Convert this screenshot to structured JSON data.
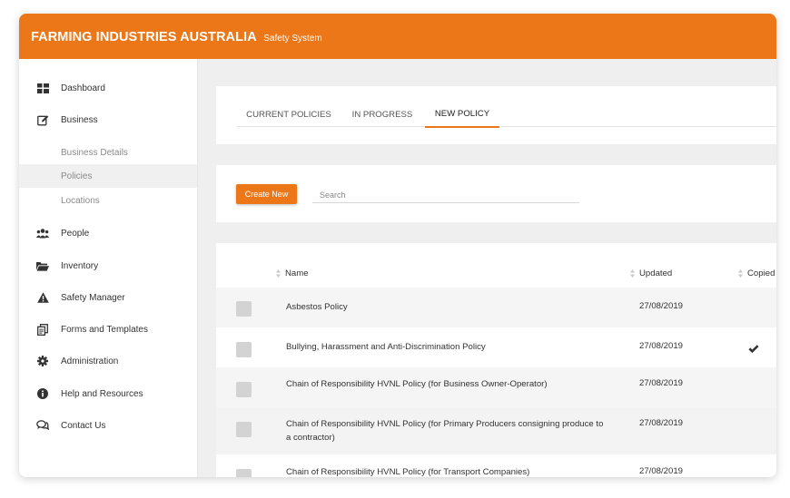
{
  "header": {
    "brand": "FARMING INDUSTRIES AUSTRALIA",
    "subtitle": "Safety System"
  },
  "sidebar": {
    "items": [
      {
        "label": "Dashboard",
        "icon": "dashboard-grid-icon"
      },
      {
        "label": "Business",
        "icon": "edit-icon"
      },
      {
        "label": "People",
        "icon": "users-icon"
      },
      {
        "label": "Inventory",
        "icon": "folder-open-icon"
      },
      {
        "label": "Safety Manager",
        "icon": "warning-icon"
      },
      {
        "label": "Forms and Templates",
        "icon": "documents-icon"
      },
      {
        "label": "Administration",
        "icon": "gear-icon"
      },
      {
        "label": "Help and Resources",
        "icon": "info-icon"
      },
      {
        "label": "Contact Us",
        "icon": "chat-icon"
      }
    ],
    "sub_items": [
      {
        "label": "Business Details"
      },
      {
        "label": "Policies",
        "active": true
      },
      {
        "label": "Locations"
      }
    ]
  },
  "tabs": [
    {
      "label": "CURRENT POLICIES"
    },
    {
      "label": "IN PROGRESS"
    },
    {
      "label": "NEW POLICY",
      "active": true
    }
  ],
  "toolbar": {
    "create_label": "Create New",
    "search_placeholder": "Search"
  },
  "table": {
    "columns": {
      "name": "Name",
      "updated": "Updated",
      "copied": "Copied"
    },
    "rows": [
      {
        "name": "Asbestos Policy",
        "updated": "27/08/2019",
        "copied": false
      },
      {
        "name": "Bullying, Harassment and Anti-Discrimination Policy",
        "updated": "27/08/2019",
        "copied": true
      },
      {
        "name": "Chain of Responsibility HVNL Policy (for Business Owner-Operator)",
        "updated": "27/08/2019",
        "copied": false
      },
      {
        "name": "Chain of Responsibility HVNL Policy (for Primary Producers consigning produce to a contractor)",
        "updated": "27/08/2019",
        "copied": false
      },
      {
        "name": "Chain of Responsibility HVNL Policy (for Transport Companies)",
        "updated": "27/08/2019",
        "copied": false
      }
    ]
  },
  "colors": {
    "accent": "#ec7718",
    "checkbox": "#d3d3d3",
    "row_alt": "#f5f5f5"
  }
}
